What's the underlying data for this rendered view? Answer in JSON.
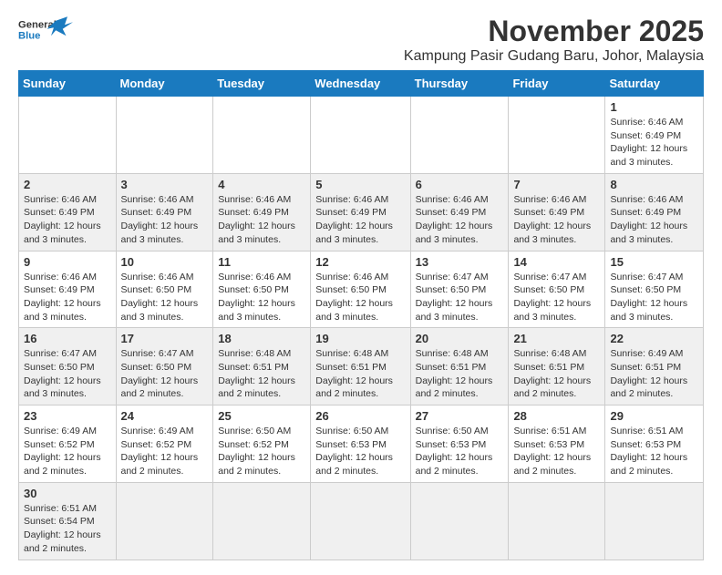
{
  "header": {
    "logo_general": "General",
    "logo_blue": "Blue",
    "month_title": "November 2025",
    "subtitle": "Kampung Pasir Gudang Baru, Johor, Malaysia"
  },
  "weekdays": [
    "Sunday",
    "Monday",
    "Tuesday",
    "Wednesday",
    "Thursday",
    "Friday",
    "Saturday"
  ],
  "weeks": [
    [
      null,
      null,
      null,
      null,
      null,
      null,
      {
        "day": "1",
        "sunrise": "Sunrise: 6:46 AM",
        "sunset": "Sunset: 6:49 PM",
        "daylight": "Daylight: 12 hours and 3 minutes."
      }
    ],
    [
      {
        "day": "2",
        "sunrise": "Sunrise: 6:46 AM",
        "sunset": "Sunset: 6:49 PM",
        "daylight": "Daylight: 12 hours and 3 minutes."
      },
      {
        "day": "3",
        "sunrise": "Sunrise: 6:46 AM",
        "sunset": "Sunset: 6:49 PM",
        "daylight": "Daylight: 12 hours and 3 minutes."
      },
      {
        "day": "4",
        "sunrise": "Sunrise: 6:46 AM",
        "sunset": "Sunset: 6:49 PM",
        "daylight": "Daylight: 12 hours and 3 minutes."
      },
      {
        "day": "5",
        "sunrise": "Sunrise: 6:46 AM",
        "sunset": "Sunset: 6:49 PM",
        "daylight": "Daylight: 12 hours and 3 minutes."
      },
      {
        "day": "6",
        "sunrise": "Sunrise: 6:46 AM",
        "sunset": "Sunset: 6:49 PM",
        "daylight": "Daylight: 12 hours and 3 minutes."
      },
      {
        "day": "7",
        "sunrise": "Sunrise: 6:46 AM",
        "sunset": "Sunset: 6:49 PM",
        "daylight": "Daylight: 12 hours and 3 minutes."
      },
      {
        "day": "8",
        "sunrise": "Sunrise: 6:46 AM",
        "sunset": "Sunset: 6:49 PM",
        "daylight": "Daylight: 12 hours and 3 minutes."
      }
    ],
    [
      {
        "day": "9",
        "sunrise": "Sunrise: 6:46 AM",
        "sunset": "Sunset: 6:49 PM",
        "daylight": "Daylight: 12 hours and 3 minutes."
      },
      {
        "day": "10",
        "sunrise": "Sunrise: 6:46 AM",
        "sunset": "Sunset: 6:50 PM",
        "daylight": "Daylight: 12 hours and 3 minutes."
      },
      {
        "day": "11",
        "sunrise": "Sunrise: 6:46 AM",
        "sunset": "Sunset: 6:50 PM",
        "daylight": "Daylight: 12 hours and 3 minutes."
      },
      {
        "day": "12",
        "sunrise": "Sunrise: 6:46 AM",
        "sunset": "Sunset: 6:50 PM",
        "daylight": "Daylight: 12 hours and 3 minutes."
      },
      {
        "day": "13",
        "sunrise": "Sunrise: 6:47 AM",
        "sunset": "Sunset: 6:50 PM",
        "daylight": "Daylight: 12 hours and 3 minutes."
      },
      {
        "day": "14",
        "sunrise": "Sunrise: 6:47 AM",
        "sunset": "Sunset: 6:50 PM",
        "daylight": "Daylight: 12 hours and 3 minutes."
      },
      {
        "day": "15",
        "sunrise": "Sunrise: 6:47 AM",
        "sunset": "Sunset: 6:50 PM",
        "daylight": "Daylight: 12 hours and 3 minutes."
      }
    ],
    [
      {
        "day": "16",
        "sunrise": "Sunrise: 6:47 AM",
        "sunset": "Sunset: 6:50 PM",
        "daylight": "Daylight: 12 hours and 3 minutes."
      },
      {
        "day": "17",
        "sunrise": "Sunrise: 6:47 AM",
        "sunset": "Sunset: 6:50 PM",
        "daylight": "Daylight: 12 hours and 2 minutes."
      },
      {
        "day": "18",
        "sunrise": "Sunrise: 6:48 AM",
        "sunset": "Sunset: 6:51 PM",
        "daylight": "Daylight: 12 hours and 2 minutes."
      },
      {
        "day": "19",
        "sunrise": "Sunrise: 6:48 AM",
        "sunset": "Sunset: 6:51 PM",
        "daylight": "Daylight: 12 hours and 2 minutes."
      },
      {
        "day": "20",
        "sunrise": "Sunrise: 6:48 AM",
        "sunset": "Sunset: 6:51 PM",
        "daylight": "Daylight: 12 hours and 2 minutes."
      },
      {
        "day": "21",
        "sunrise": "Sunrise: 6:48 AM",
        "sunset": "Sunset: 6:51 PM",
        "daylight": "Daylight: 12 hours and 2 minutes."
      },
      {
        "day": "22",
        "sunrise": "Sunrise: 6:49 AM",
        "sunset": "Sunset: 6:51 PM",
        "daylight": "Daylight: 12 hours and 2 minutes."
      }
    ],
    [
      {
        "day": "23",
        "sunrise": "Sunrise: 6:49 AM",
        "sunset": "Sunset: 6:52 PM",
        "daylight": "Daylight: 12 hours and 2 minutes."
      },
      {
        "day": "24",
        "sunrise": "Sunrise: 6:49 AM",
        "sunset": "Sunset: 6:52 PM",
        "daylight": "Daylight: 12 hours and 2 minutes."
      },
      {
        "day": "25",
        "sunrise": "Sunrise: 6:50 AM",
        "sunset": "Sunset: 6:52 PM",
        "daylight": "Daylight: 12 hours and 2 minutes."
      },
      {
        "day": "26",
        "sunrise": "Sunrise: 6:50 AM",
        "sunset": "Sunset: 6:53 PM",
        "daylight": "Daylight: 12 hours and 2 minutes."
      },
      {
        "day": "27",
        "sunrise": "Sunrise: 6:50 AM",
        "sunset": "Sunset: 6:53 PM",
        "daylight": "Daylight: 12 hours and 2 minutes."
      },
      {
        "day": "28",
        "sunrise": "Sunrise: 6:51 AM",
        "sunset": "Sunset: 6:53 PM",
        "daylight": "Daylight: 12 hours and 2 minutes."
      },
      {
        "day": "29",
        "sunrise": "Sunrise: 6:51 AM",
        "sunset": "Sunset: 6:53 PM",
        "daylight": "Daylight: 12 hours and 2 minutes."
      }
    ],
    [
      {
        "day": "30",
        "sunrise": "Sunrise: 6:51 AM",
        "sunset": "Sunset: 6:54 PM",
        "daylight": "Daylight: 12 hours and 2 minutes."
      },
      null,
      null,
      null,
      null,
      null,
      null
    ]
  ]
}
